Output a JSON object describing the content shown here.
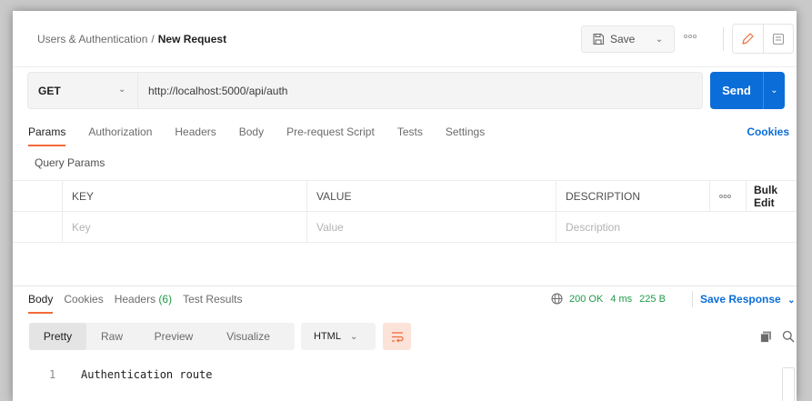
{
  "header": {
    "breadcrumb_parent": "Users & Authentication",
    "breadcrumb_separator": "/",
    "breadcrumb_current": "New Request",
    "save_label": "Save",
    "save_icon": "floppy-disk-icon",
    "more_icon": "more-dots-icon",
    "mode_icons": [
      "pencil-icon",
      "document-icon"
    ]
  },
  "request": {
    "method": "GET",
    "url": "http://localhost:5000/api/auth",
    "send_label": "Send"
  },
  "request_tabs": {
    "items": [
      "Params",
      "Authorization",
      "Headers",
      "Body",
      "Pre-request Script",
      "Tests",
      "Settings"
    ],
    "active": "Params",
    "cookies_label": "Cookies"
  },
  "query_params": {
    "title": "Query Params",
    "columns": {
      "key": "KEY",
      "value": "VALUE",
      "description": "DESCRIPTION",
      "bulk_edit": "Bulk Edit",
      "more": "ooo"
    },
    "placeholders": {
      "key": "Key",
      "value": "Value",
      "description": "Description"
    }
  },
  "response": {
    "tabs": {
      "body": "Body",
      "cookies": "Cookies",
      "headers": "Headers",
      "headers_count": "(6)",
      "test_results": "Test Results"
    },
    "status": "200 OK",
    "time": "4 ms",
    "size": "225 B",
    "save_response_label": "Save Response",
    "view_modes": [
      "Pretty",
      "Raw",
      "Preview",
      "Visualize"
    ],
    "active_view": "Pretty",
    "language": "HTML",
    "lines": [
      {
        "number": "1",
        "text": "Authentication route"
      }
    ]
  },
  "colors": {
    "accent": "#0b6dd8",
    "tab_indicator": "#f26b3a",
    "status_ok": "#1e9b47"
  }
}
